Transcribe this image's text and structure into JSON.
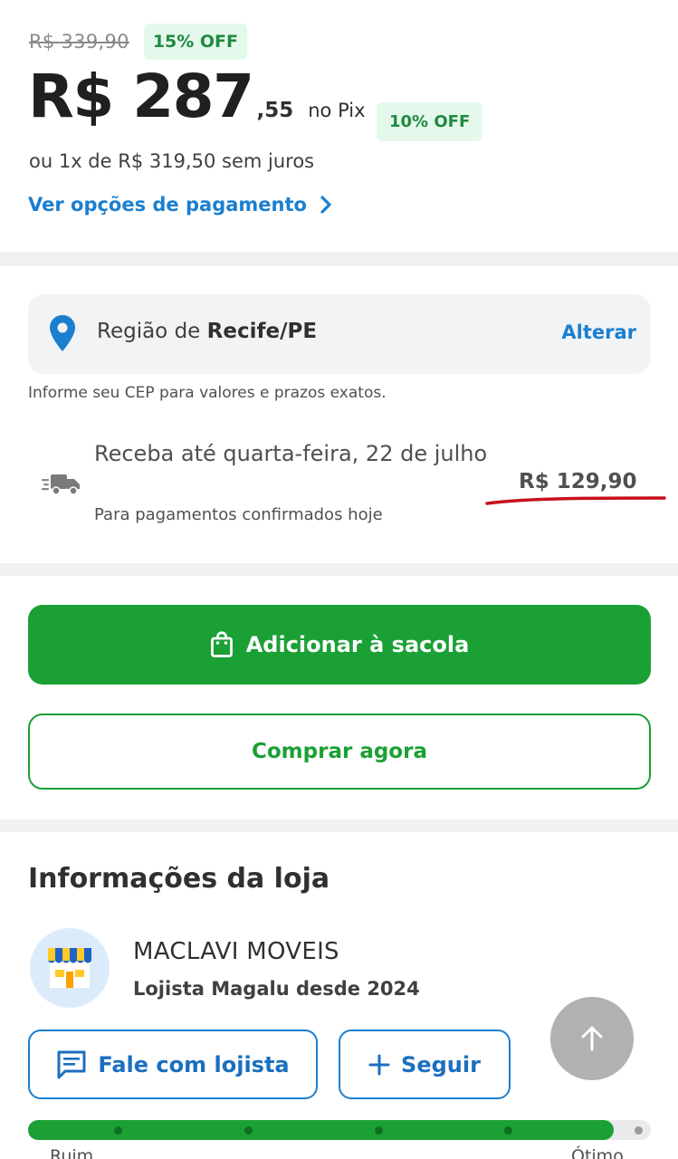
{
  "price": {
    "old_price": "R$ 339,90",
    "old_discount_badge": "15% OFF",
    "main_integer": "R$ 287",
    "main_cents": ",55",
    "pix_label": "no Pix",
    "pix_discount_badge": "10% OFF",
    "installments": "ou 1x de R$ 319,50 sem juros",
    "payment_options_link": "Ver opções de pagamento"
  },
  "shipping": {
    "region_prefix": "Região de",
    "region_city": "Recife/PE",
    "change_label": "Alterar",
    "cep_info": "Informe seu CEP para valores e prazos exatos.",
    "delivery_title": "Receba até quarta-feira, 22 de julho",
    "delivery_subtitle": "Para pagamentos confirmados hoje",
    "shipping_price": "R$ 129,90"
  },
  "actions": {
    "add_to_bag_label": "Adicionar à sacola",
    "buy_now_label": "Comprar agora"
  },
  "store": {
    "heading": "Informações da loja",
    "name": "MACLAVI MOVEIS",
    "since": "Lojista Magalu desde 2024",
    "chat_label": "Fale com lojista",
    "follow_label": "Seguir",
    "rating": {
      "level": 0.94,
      "segments": 5,
      "label_low": "Ruim",
      "label_high": "Ótimo"
    }
  },
  "icons": {
    "pin": "location-pin-icon",
    "truck": "truck-icon",
    "bag": "shopping-bag-icon",
    "chat": "chat-icon",
    "plus": "plus-icon",
    "arrow_up": "arrow-up-icon",
    "chevron": "chevron-right-icon",
    "store": "store-icon"
  },
  "colors": {
    "brand_green": "#1ba035",
    "link_blue": "#1b7fd0",
    "badge_bg": "#e5f8ec",
    "badge_text": "#1f8a3f",
    "annotation_red": "#c8101a"
  }
}
